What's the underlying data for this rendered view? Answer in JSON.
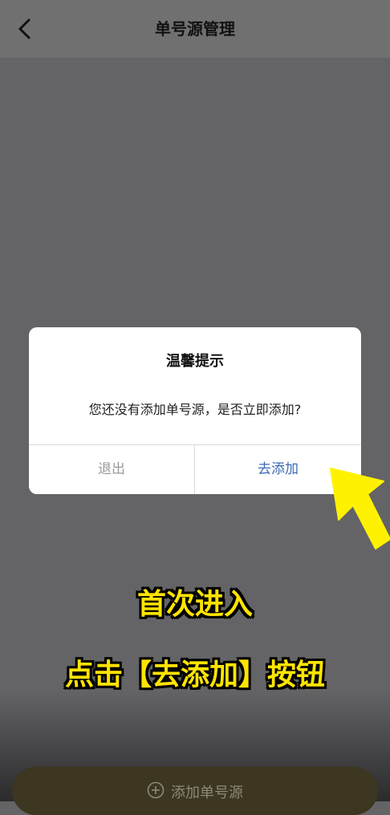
{
  "header": {
    "title": "单号源管理"
  },
  "dialog": {
    "title": "温馨提示",
    "message": "您还没有添加单号源，是否立即添加?",
    "cancel_label": "退出",
    "confirm_label": "去添加"
  },
  "overlay_caption": {
    "line1": "首次进入",
    "line2": "点击【去添加】按钮"
  },
  "bottom_button": {
    "label": "添加单号源"
  },
  "colors": {
    "caption_yellow": "#ffe400",
    "confirm_blue": "#3e6bb3",
    "arrow_yellow": "#fff200"
  },
  "icons": {
    "back": "chevron-left-icon",
    "add": "plus-circle-icon",
    "pointer": "arrow-pointer-icon"
  }
}
